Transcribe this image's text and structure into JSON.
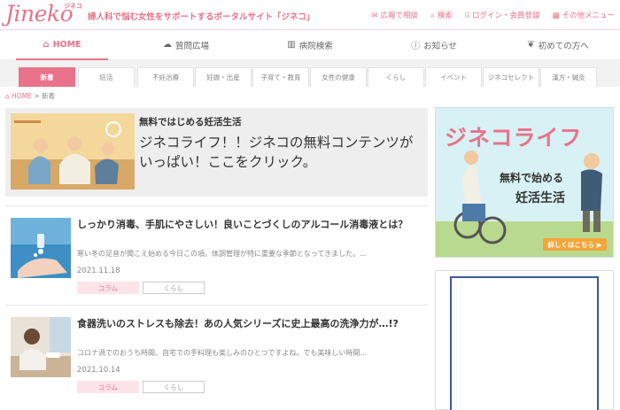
{
  "site": {
    "logo": "Jineko",
    "logo_sub": "ジネコ",
    "tagline": "婦人科で悩む女性をサポートするポータルサイト「ジネコ」"
  },
  "toplinks": [
    {
      "icon": "envelope-icon",
      "label": "広報で相談"
    },
    {
      "icon": "search-icon",
      "label": "検索"
    },
    {
      "icon": "login-icon",
      "label": "ログイン・会員登録"
    },
    {
      "icon": "grid-icon",
      "label": "その他メニュー"
    }
  ],
  "mainnav": [
    {
      "icon": "home-icon",
      "label": "HOME",
      "active": true
    },
    {
      "icon": "chat-icon",
      "label": "質問広場"
    },
    {
      "icon": "hospital-icon",
      "label": "病院検索"
    },
    {
      "icon": "info-icon",
      "label": "お知らせ"
    },
    {
      "icon": "leaf-icon",
      "label": "初めての方へ"
    }
  ],
  "categories": [
    "新着",
    "妊活",
    "不妊治療",
    "妊娠・出産",
    "子育て・教育",
    "女性の健康",
    "くらし",
    "イベント",
    "ジネコセレクト",
    "漢方・鍼灸"
  ],
  "breadcrumb": {
    "home": "HOME",
    "sep": ">",
    "current": "新着"
  },
  "feature": {
    "kicker": "無料ではじめる妊活生活",
    "title": "ジネコライフ！！ジネコの無料コンテンツがいっぱい！ここをクリック。"
  },
  "articles": [
    {
      "title": "しっかり消毒、手肌にやさしい！良いことづくしのアルコール消毒液とは？",
      "desc": "寒い冬の足音が聞こえ始める今日この頃。体調管理が特に重要な季節となってきました。…",
      "date": "2021.11.18",
      "tags": [
        "コラム",
        "くらし"
      ]
    },
    {
      "title": "食器洗いのストレスも除去！あの人気シリーズに史上最高の洗浄力が…!?",
      "desc": "コロナ渦でのおうち時間、自宅での手料理も楽しみのひとつですよね。でも美味しい時間…",
      "date": "2021.10.14",
      "tags": [
        "コラム",
        "くらし"
      ]
    }
  ],
  "sidebar": {
    "ad_title": "ジネコライフ",
    "ad_sub1": "無料で始める",
    "ad_sub2": "妊活生活",
    "ad_button": "詳しくはこちら ▶"
  },
  "colors": {
    "accent": "#e8738a",
    "feature_bg": "#eeeeee",
    "ad_bg": "#d8f1f4"
  }
}
